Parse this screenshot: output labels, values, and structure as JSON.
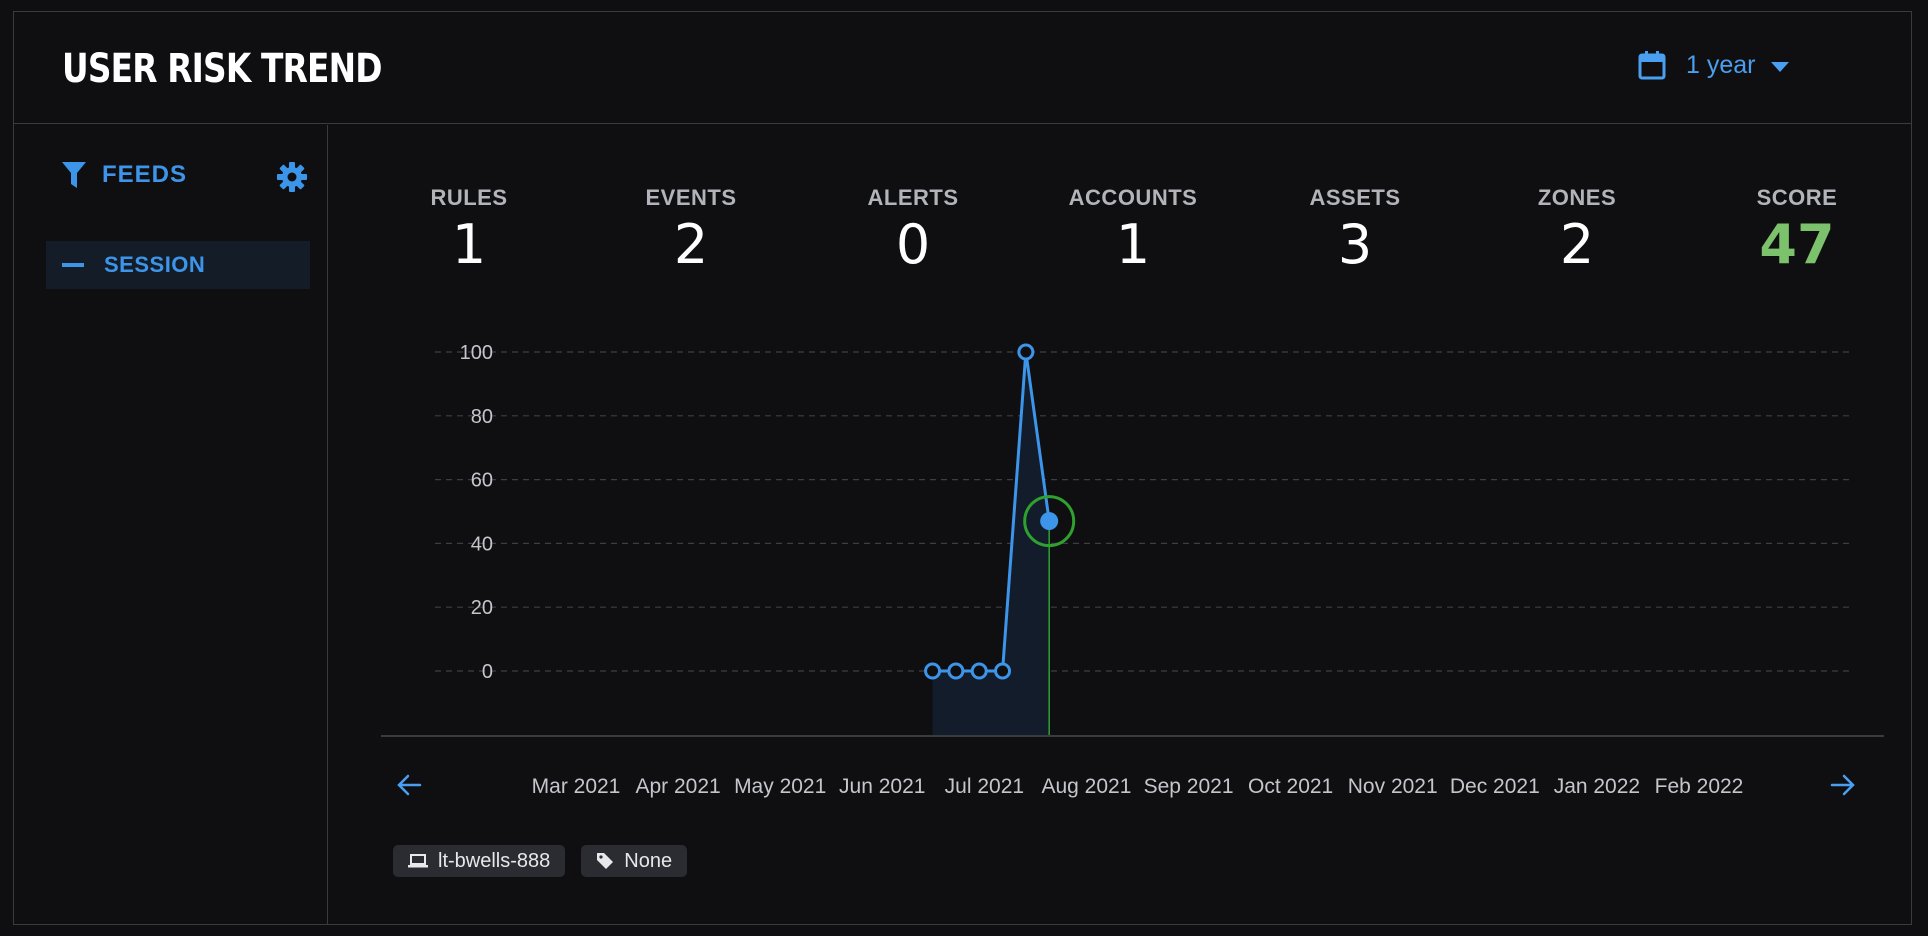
{
  "header": {
    "title": "USER RISK TREND",
    "range_label": "1 year"
  },
  "sidebar": {
    "feeds_label": "FEEDS",
    "items": [
      {
        "label": "SESSION"
      }
    ]
  },
  "stats": [
    {
      "label": "RULES",
      "value": "1"
    },
    {
      "label": "EVENTS",
      "value": "2"
    },
    {
      "label": "ALERTS",
      "value": "0"
    },
    {
      "label": "ACCOUNTS",
      "value": "1"
    },
    {
      "label": "ASSETS",
      "value": "3"
    },
    {
      "label": "ZONES",
      "value": "2"
    },
    {
      "label": "SCORE",
      "value": "47"
    }
  ],
  "colors": {
    "accent": "#3d95ea",
    "score": "#7cc16b",
    "current_marker": "#2ea12e"
  },
  "chart_data": {
    "type": "line",
    "x_ticks": [
      "Mar 2021",
      "Apr 2021",
      "May 2021",
      "Jun 2021",
      "Jul 2021",
      "Aug 2021",
      "Sep 2021",
      "Oct 2021",
      "Nov 2021",
      "Dec 2021",
      "Jan 2022",
      "Feb 2022"
    ],
    "y_ticks": [
      "100",
      "80",
      "60",
      "40",
      "20",
      "0"
    ],
    "ylim": [
      0,
      100
    ],
    "grid": true,
    "series": [
      {
        "x": [
          "2021-06-16",
          "2021-06-23",
          "2021-06-30",
          "2021-07-07",
          "2021-07-14",
          "2021-07-21"
        ],
        "y": [
          0,
          0,
          0,
          0,
          100,
          47
        ]
      }
    ],
    "current_point": {
      "x": "2021-07-21",
      "y": 47
    }
  },
  "tags": [
    {
      "icon": "laptop-icon",
      "label": "lt-bwells-888"
    },
    {
      "icon": "tag-icon",
      "label": "None"
    }
  ]
}
